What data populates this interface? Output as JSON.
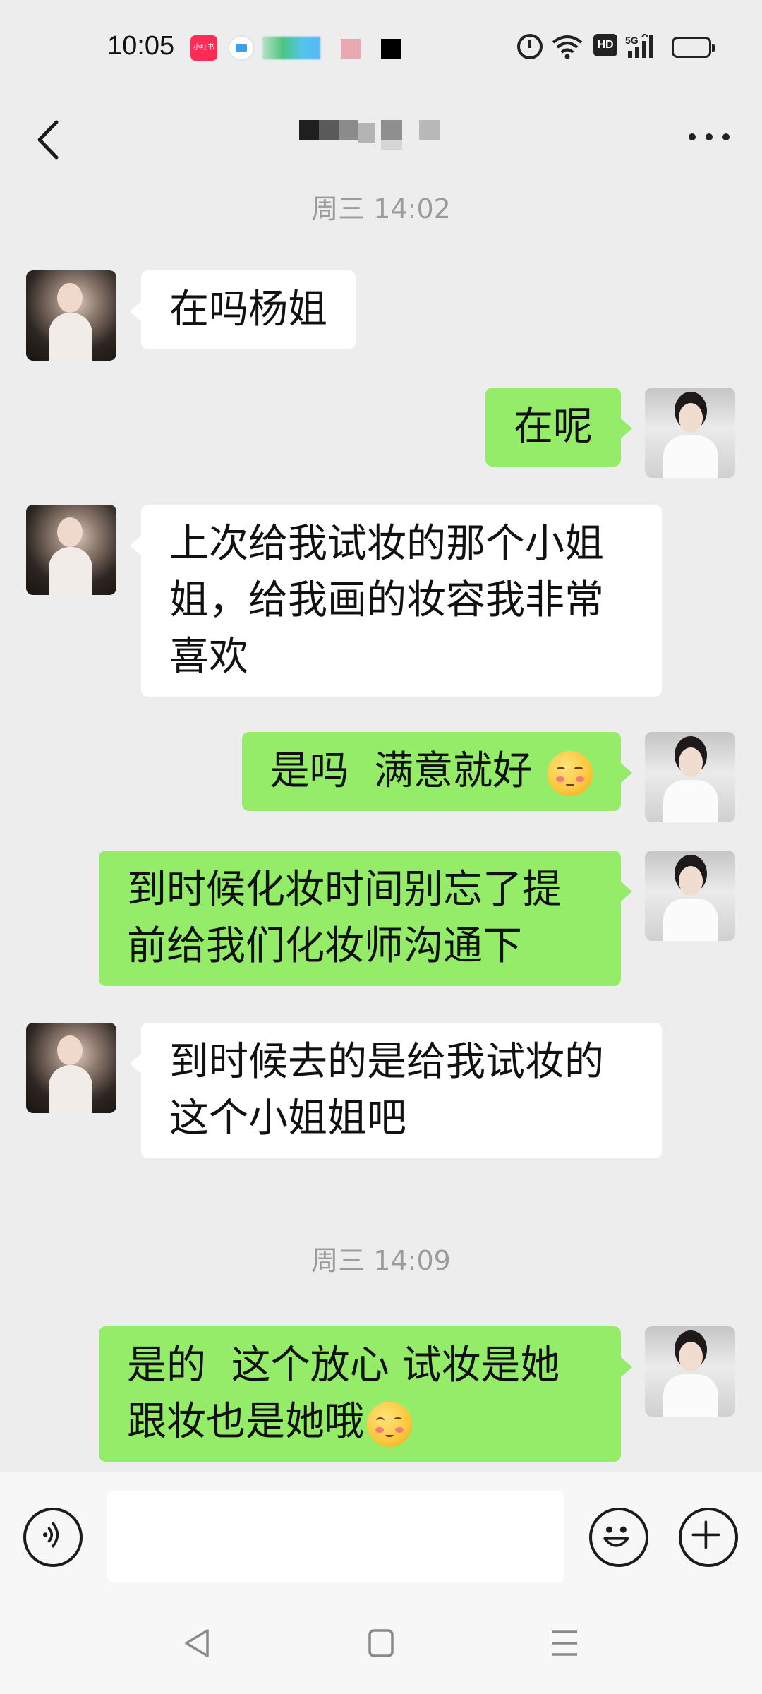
{
  "status_bar": {
    "time": "10:05",
    "notification_icons": [
      "xiaohongshu-icon",
      "app-icon",
      "blurred-icons"
    ],
    "system_icons": [
      "alarm-icon",
      "wifi-icon",
      "hd-icon",
      "signal-5g-icon",
      "battery-icon"
    ],
    "hd_label": "HD"
  },
  "nav": {
    "back_icon": "chevron-left-icon",
    "more_icon": "more-dots-icon"
  },
  "timestamps": [
    "周三 14:02",
    "周三 14:09"
  ],
  "messages": [
    {
      "side": "in",
      "text": "在吗杨姐"
    },
    {
      "side": "out",
      "text": "在呢"
    },
    {
      "side": "in",
      "text": "上次给我试妆的那个小姐\n姐，给我画的妆容我非常\n喜欢"
    },
    {
      "side": "out",
      "text": "是吗  满意就好",
      "emoji": "blush-smile-emoji"
    },
    {
      "side": "out",
      "text": "到时候化妆时间别忘了提\n前给我们化妆师沟通下"
    },
    {
      "side": "in",
      "text": "到时候去的是给我试妆的\n这个小姐姐吧"
    },
    {
      "side": "out",
      "text": "是的  这个放心 试妆是她\n跟妆也是她哦",
      "emoji": "blush-smile-emoji"
    }
  ],
  "input_bar": {
    "voice_icon": "voice-icon",
    "input_value": "",
    "emoji_icon": "smiley-icon",
    "plus_icon": "plus-circle-icon"
  },
  "system_nav": [
    "back-triangle-icon",
    "home-square-icon",
    "recents-menu-icon"
  ],
  "colors": {
    "chat_background": "#EDEDED",
    "outgoing_bubble": "#95EC69",
    "incoming_bubble": "#FFFFFF",
    "timestamp_text": "#9B9B9B"
  }
}
